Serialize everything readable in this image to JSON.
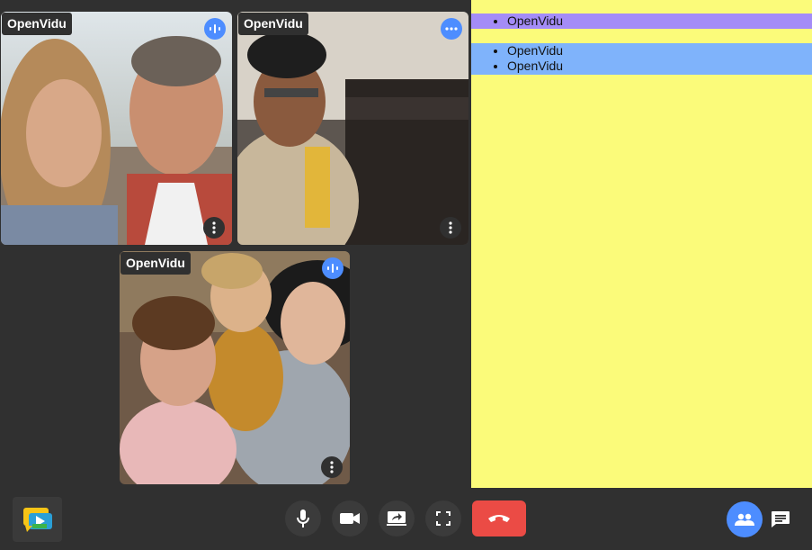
{
  "participants": [
    {
      "name": "OpenVidu",
      "audio_icon": "audio-waves-icon",
      "menu_icon": "more-vert-icon"
    },
    {
      "name": "OpenVidu",
      "audio_icon": "more-horiz-icon",
      "menu_icon": "more-vert-icon"
    },
    {
      "name": "OpenVidu",
      "audio_icon": "audio-waves-icon",
      "menu_icon": "more-vert-icon"
    }
  ],
  "side_panel": {
    "list_a": [
      "OpenVidu"
    ],
    "list_b": [
      "OpenVidu",
      "OpenVidu"
    ]
  },
  "toolbar": {
    "logo_icon": "openvidu-logo-icon",
    "buttons": [
      "microphone-icon",
      "camera-icon",
      "screen-share-icon",
      "fullscreen-icon",
      "hang-up-icon",
      "participants-icon",
      "chat-icon"
    ]
  },
  "colors": {
    "background": "#303030",
    "panel": "#fbfb7a",
    "list_a_bg": "#a48cf7",
    "list_b_bg": "#7fb3fb",
    "accent_blue": "#4d8dff",
    "hangup_red": "#eb4b45"
  }
}
